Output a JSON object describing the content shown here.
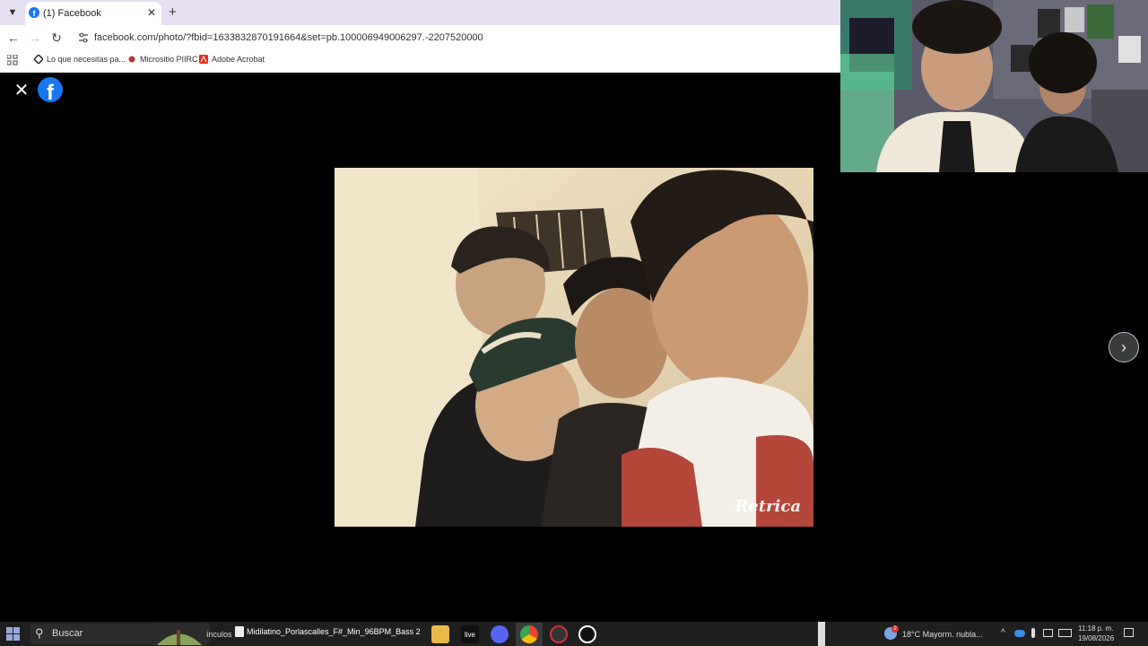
{
  "browser": {
    "tab": {
      "title": "(1) Facebook"
    },
    "address_url": "facebook.com/photo/?fbid=1633832870191664&set=pb.100006949006297.-2207520000",
    "bookmarks": [
      "Lo que necesitas pa...",
      "Micrositio PIIRC",
      "Adobe Acrobat"
    ]
  },
  "photo_viewer": {
    "watermark": "Retrica"
  },
  "taskbar": {
    "search_placeholder": "Buscar",
    "cut_text": "ínculos",
    "active_window": "Midilatino_Porlascalles_F#_Min_96BPM_Bass 2",
    "live_label": "live",
    "weather_badge": "2",
    "weather": "18°C  Mayorm. nubla...",
    "time": "11:18 p. m.",
    "date": "19/08/2026"
  },
  "colors": {
    "facebook_blue": "#1877f2",
    "tab_strip": "#e6dff2"
  },
  "icons": [
    "chevron-down-icon",
    "facebook-icon",
    "close-icon",
    "plus-icon",
    "back-icon",
    "forward-icon",
    "reload-icon",
    "site-info-icon",
    "apps-icon",
    "windows-icon",
    "search-icon",
    "chevron-right-icon"
  ]
}
